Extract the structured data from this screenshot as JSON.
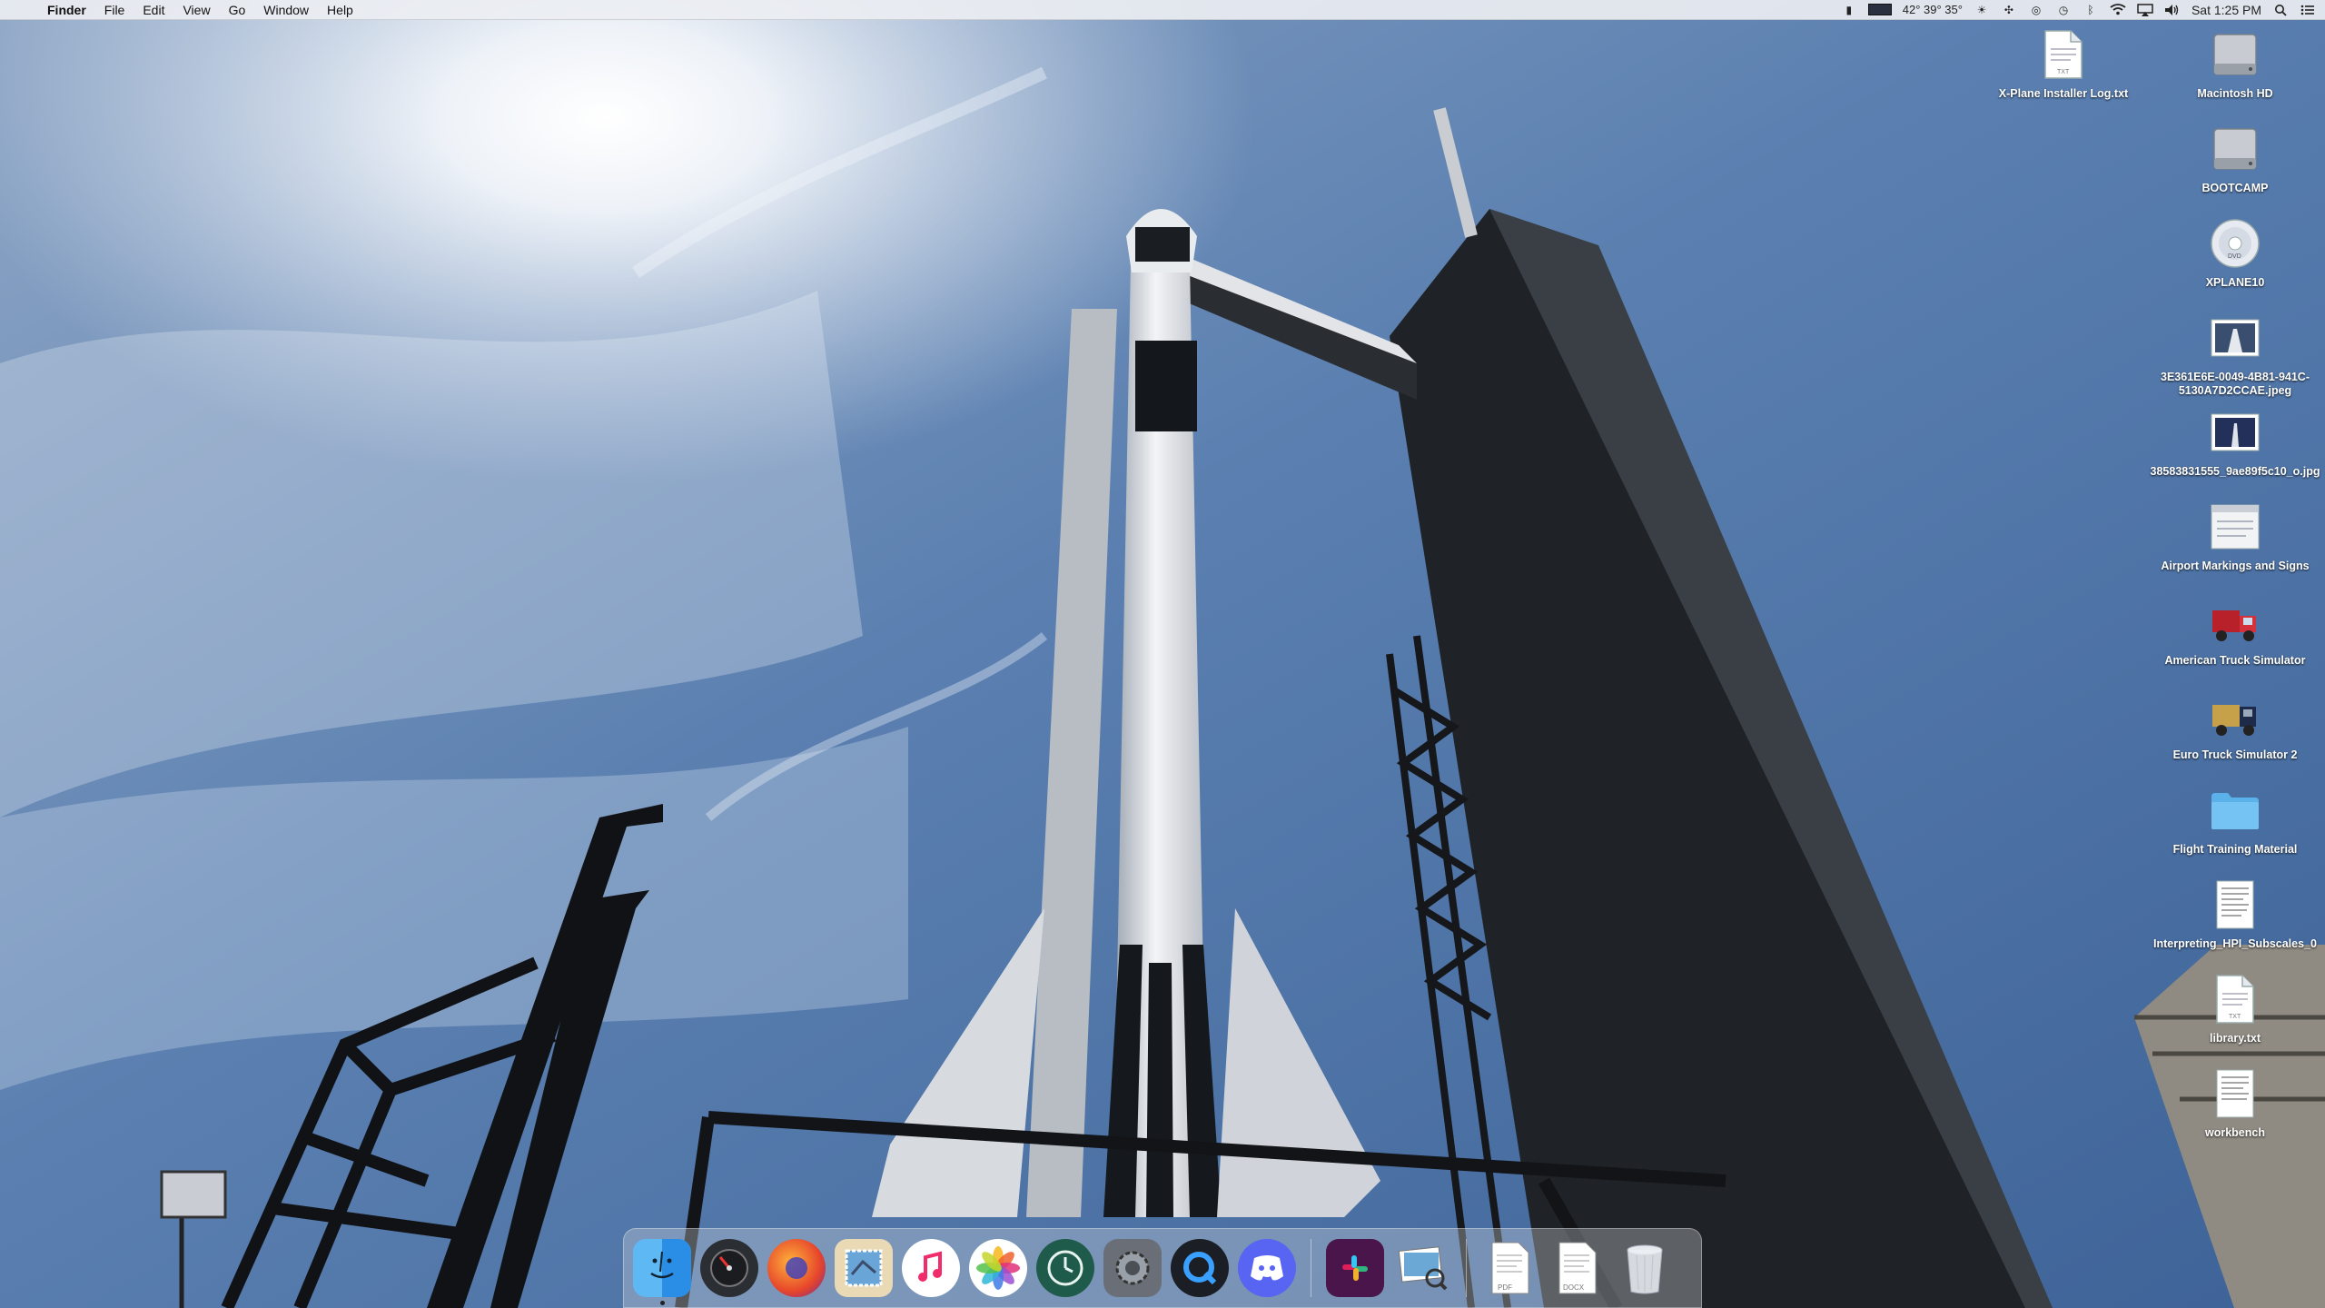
{
  "menubar": {
    "app_name": "Finder",
    "menus": [
      "File",
      "Edit",
      "View",
      "Go",
      "Window",
      "Help"
    ],
    "status": {
      "weather_temps": "42° 39° 35°",
      "clock": "Sat 1:25 PM"
    }
  },
  "desktop": {
    "items": [
      {
        "label": "X-Plane Installer Log.txt",
        "icon": "text-file-icon"
      },
      {
        "label": "Macintosh HD",
        "icon": "hard-drive-icon"
      },
      {
        "label": "BOOTCAMP",
        "icon": "hard-drive-icon"
      },
      {
        "label": "XPLANE10",
        "icon": "dvd-icon"
      },
      {
        "label": "3E361E6E-0049-4B81-941C-5130A7D2CCAE.jpeg",
        "icon": "image-file-icon"
      },
      {
        "label": "38583831555_9ae89f5c10_o.jpg",
        "icon": "image-file-icon"
      },
      {
        "label": "Airport Markings and Signs",
        "icon": "document-icon"
      },
      {
        "label": "American Truck Simulator",
        "icon": "truck-app-icon"
      },
      {
        "label": "Euro Truck Simulator 2",
        "icon": "truck-app-icon"
      },
      {
        "label": "Flight Training Material",
        "icon": "folder-icon"
      },
      {
        "label": "Interpreting_HPI_Subscales_0",
        "icon": "document-icon"
      },
      {
        "label": "library.txt",
        "icon": "text-file-icon"
      },
      {
        "label": "workbench",
        "icon": "document-icon"
      }
    ]
  },
  "dock": {
    "apps": [
      "Finder",
      "Dashboard",
      "Firefox",
      "Mail",
      "iTunes",
      "Photos",
      "Time Machine",
      "System Preferences",
      "QuickTime Player",
      "Discord",
      "Slack",
      "Preview",
      "PDF",
      "DOCX",
      "Trash"
    ],
    "file_labels": {
      "pdf": "PDF",
      "docx": "DOCX"
    }
  }
}
